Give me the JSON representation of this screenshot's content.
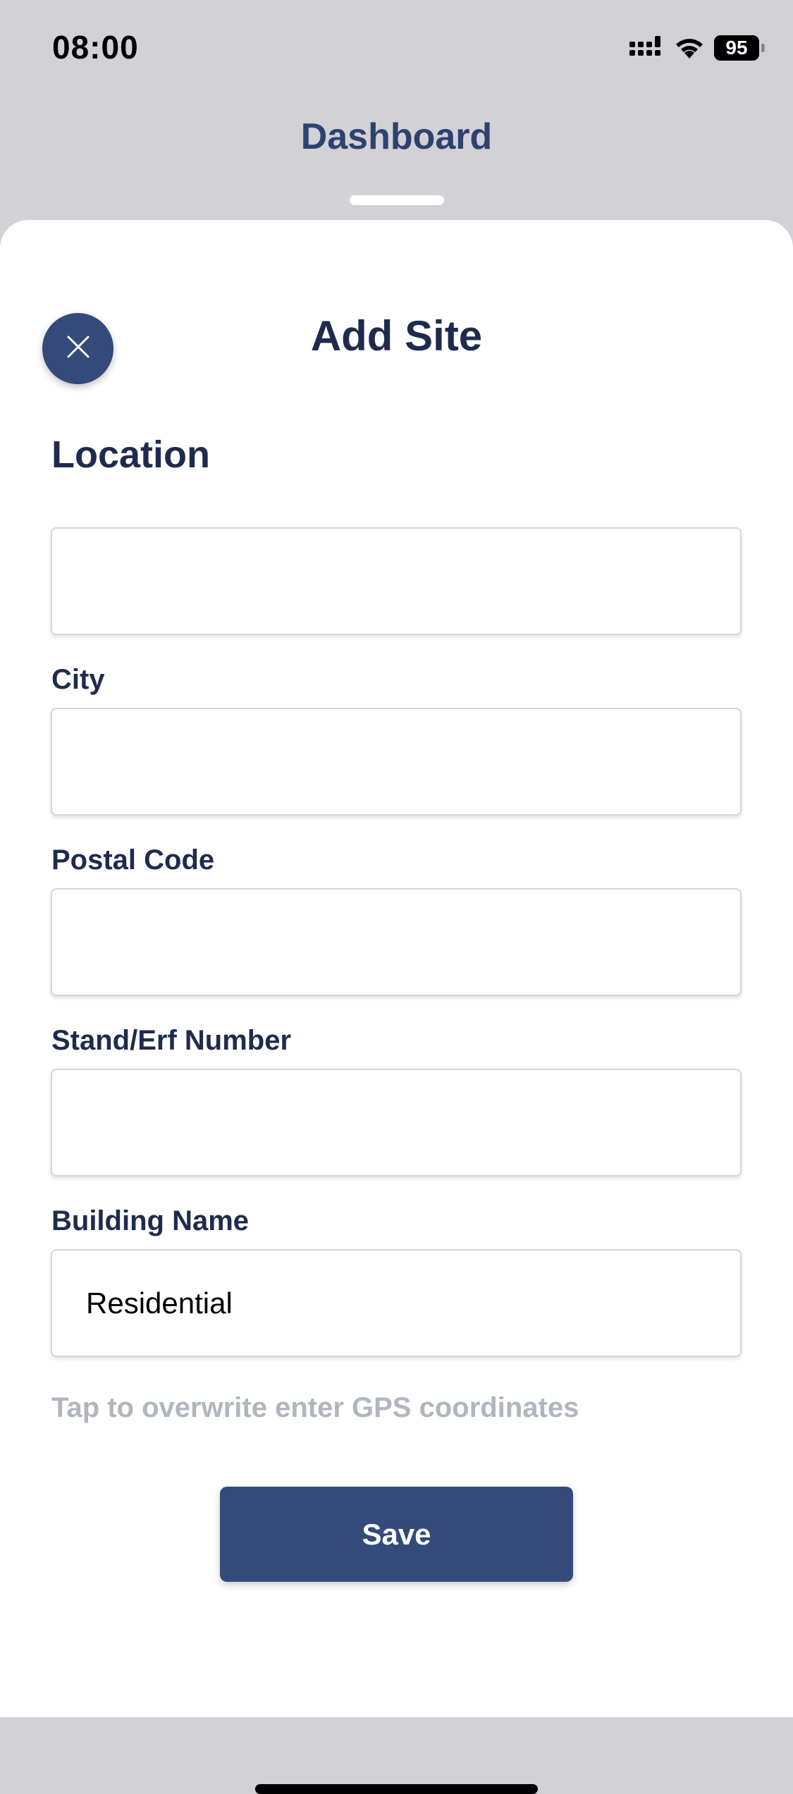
{
  "status_bar": {
    "time": "08:00",
    "battery": "95",
    "icons": [
      "signal-icon",
      "wifi-icon",
      "battery-icon"
    ]
  },
  "background": {
    "title": "Dashboard"
  },
  "sheet": {
    "title": "Add Site",
    "close_icon": "close-icon",
    "section_title": "Location",
    "fields": [
      {
        "label": "",
        "value": "",
        "placeholder": ""
      },
      {
        "label": "City",
        "value": "",
        "placeholder": ""
      },
      {
        "label": "Postal Code",
        "value": "",
        "placeholder": ""
      },
      {
        "label": "Stand/Erf Number",
        "value": "",
        "placeholder": ""
      },
      {
        "label": "Building Name",
        "value": "Residential",
        "placeholder": ""
      }
    ],
    "gps_link": "Tap to overwrite enter GPS coordinates",
    "save_label": "Save"
  },
  "colors": {
    "primary": "#334a7a",
    "heading": "#1e2b4d",
    "muted": "#b0b5bf",
    "backdrop": "#d1d1d6"
  }
}
